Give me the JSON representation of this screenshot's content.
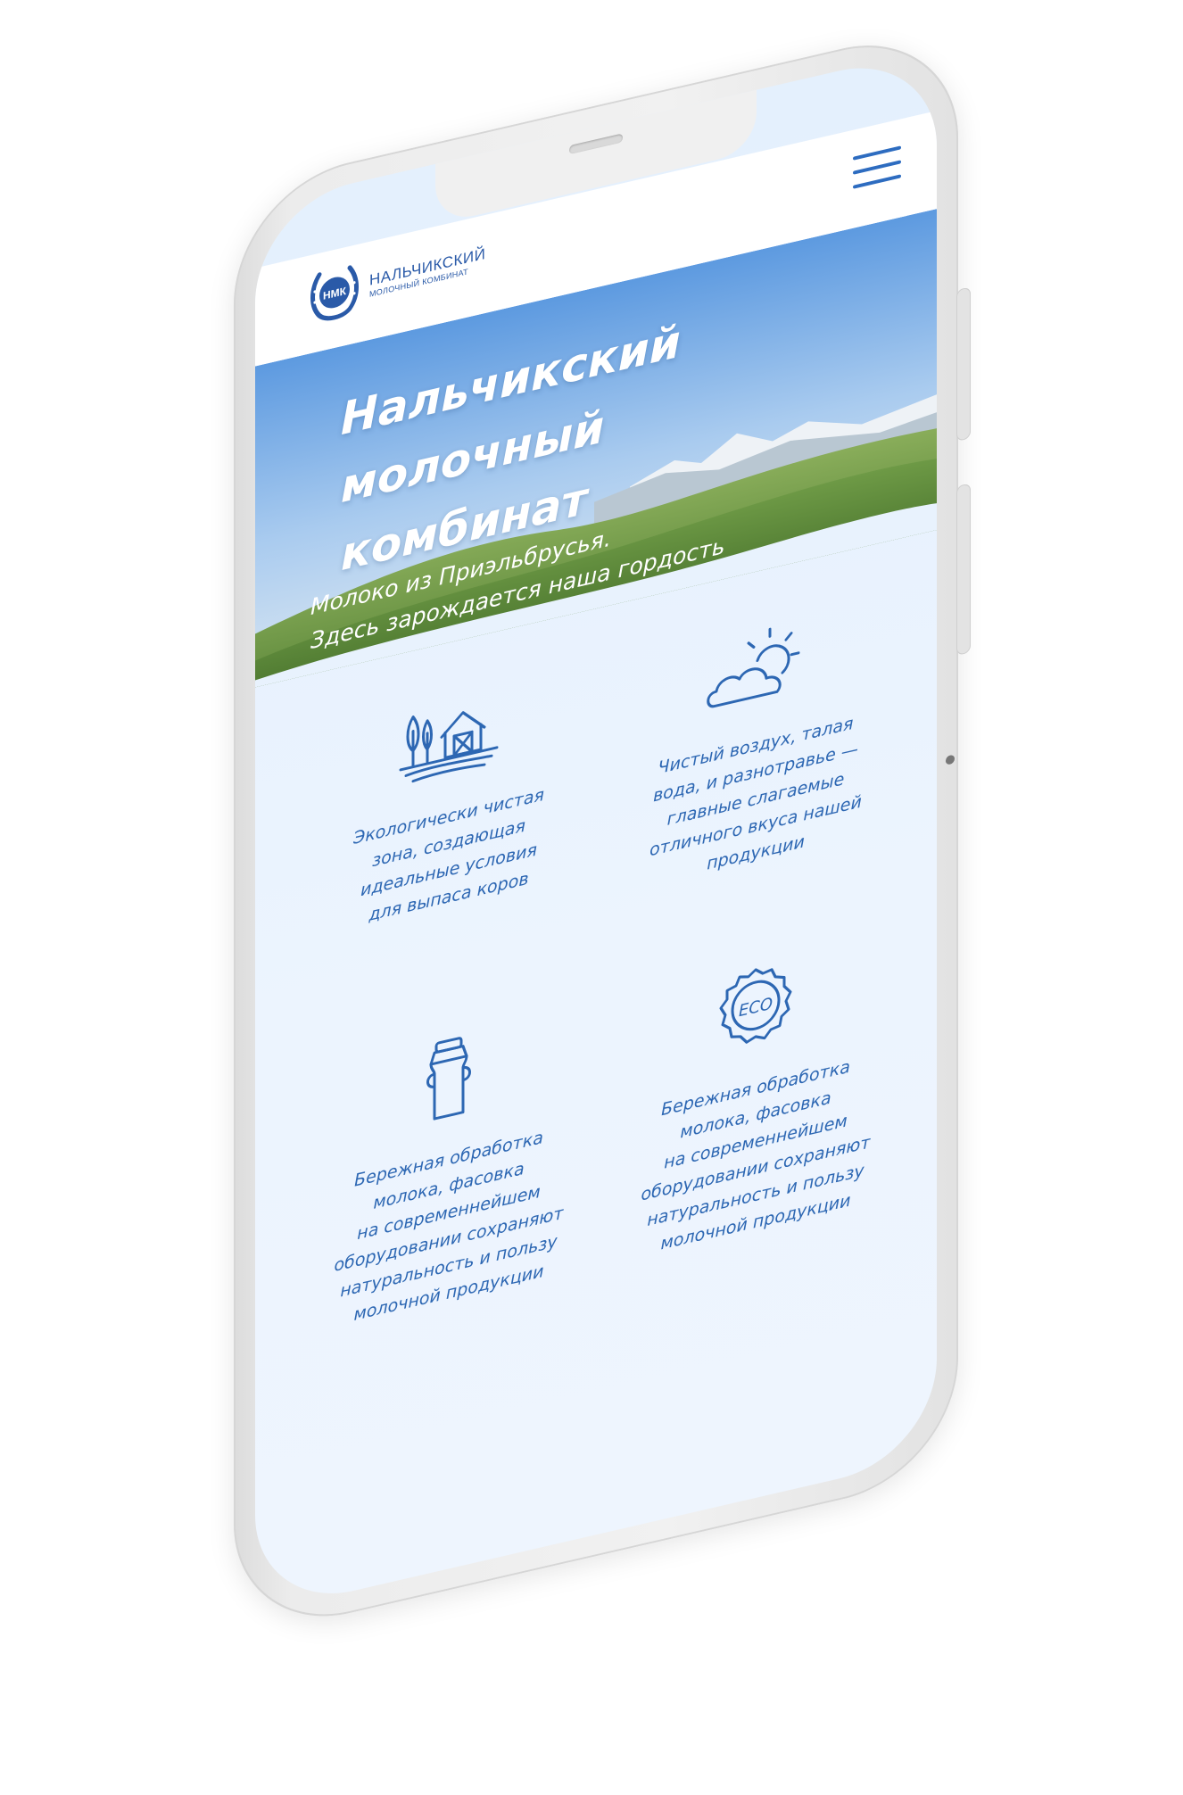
{
  "header": {
    "logo": {
      "emblem_text": "НМК",
      "line1": "НАЛЬЧИКСКИЙ",
      "line2": "МОЛОЧНЫЙ КОМБИНАТ"
    },
    "menu_icon": "hamburger-menu-icon"
  },
  "hero": {
    "title": "Нальчикский\nмолочный\nкомбинат",
    "subtitle": "Молоко из Приэльбрусья.\nЗдесь зарождается наша гордость"
  },
  "features": [
    {
      "icon": "farm-icon",
      "text": "Экологически чистая\nзона, создающая\nидеальные условия\nдля выпаса коров"
    },
    {
      "icon": "sun-cloud-icon",
      "text": "Чистый воздух, талая\nвода, и разнотравье —\nглавные слагаемые\nотличного вкуса нашей\nпродукции"
    },
    {
      "icon": "milk-can-icon",
      "text": "Бережная обработка\nмолока, фасовка\nна современнейшем\nоборудовании сохраняют\nнатуральность и пользу\nмолочной продукции"
    },
    {
      "icon": "eco-badge-icon",
      "eco_label": "ECO",
      "text": "Бережная обработка\nмолока, фасовка\nна современнейшем\nоборудовании сохраняют\nнатуральность и пользу\nмолочной продукции"
    }
  ],
  "colors": {
    "accent_blue": "#2d67b3",
    "screen_bg": "#e8f2fd",
    "sky": "#7fb1e6",
    "hills": "#6f9a45",
    "phone_frame": "#ececec"
  }
}
